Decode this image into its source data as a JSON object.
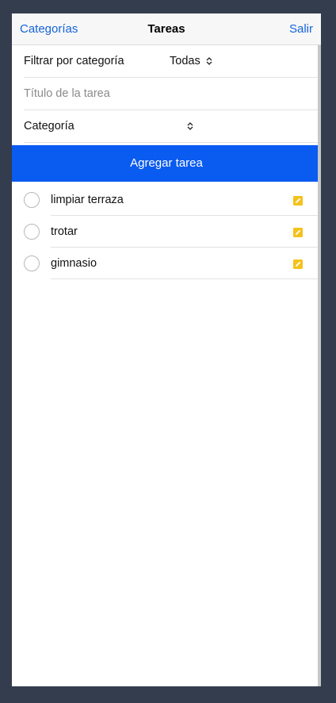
{
  "navbar": {
    "left_label": "Categorías",
    "title": "Tareas",
    "right_label": "Salir"
  },
  "filter": {
    "label": "Filtrar por categoría",
    "selected": "Todas"
  },
  "new_task": {
    "title_placeholder": "Título de la tarea",
    "category_label": "Categoría",
    "add_button": "Agregar tarea"
  },
  "tasks": [
    {
      "label": "limpiar terraza",
      "done": false
    },
    {
      "label": "trotar",
      "done": false
    },
    {
      "label": "gimnasio",
      "done": false
    }
  ],
  "icons": {
    "select_arrows": "chevron-up-down-icon",
    "task_checkbox": "circle-checkbox-icon",
    "edit": "edit-icon"
  },
  "colors": {
    "accent": "#1463d9",
    "button": "#0a5bf0",
    "edit_icon": "#f5c21b",
    "background": "#343d4d"
  }
}
